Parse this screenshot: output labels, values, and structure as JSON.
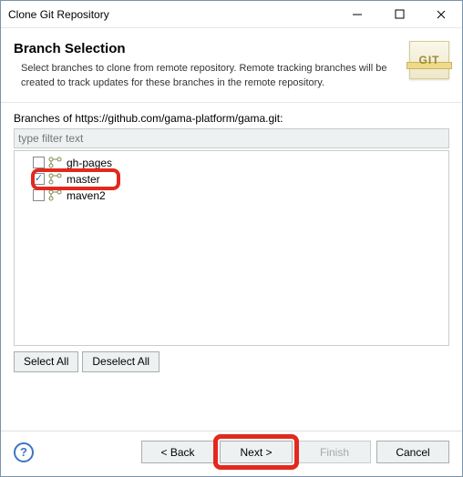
{
  "window": {
    "title": "Clone Git Repository"
  },
  "header": {
    "heading": "Branch Selection",
    "desc": "Select branches to clone from remote repository. Remote tracking branches will be created to track updates for these branches in the remote repository."
  },
  "git_badge": "GIT",
  "branches_label": "Branches of https://github.com/gama-platform/gama.git:",
  "filter_placeholder": "type filter text",
  "branches": [
    {
      "name": "gh-pages",
      "checked": false
    },
    {
      "name": "master",
      "checked": true
    },
    {
      "name": "maven2",
      "checked": false
    }
  ],
  "buttons": {
    "select_all": "Select All",
    "deselect_all": "Deselect All",
    "back": "< Back",
    "next": "Next >",
    "finish": "Finish",
    "cancel": "Cancel"
  }
}
